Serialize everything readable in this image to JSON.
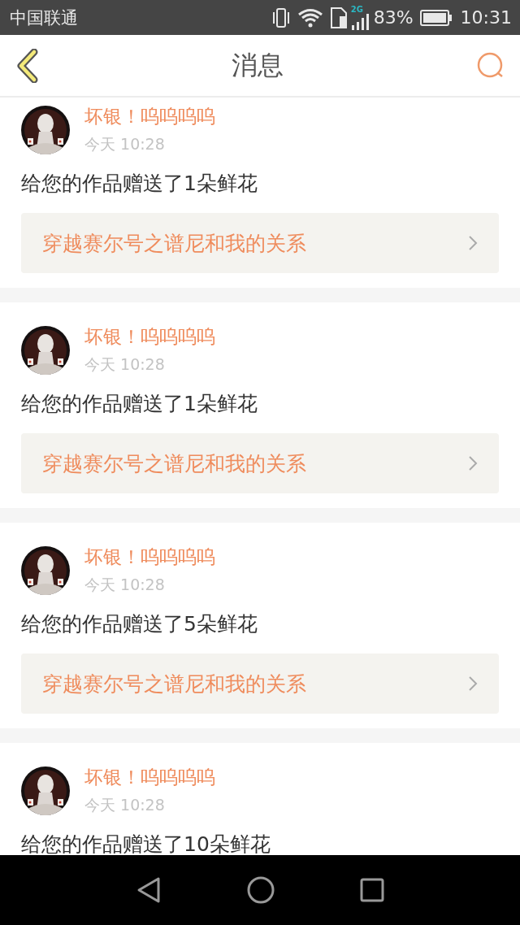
{
  "status_bar": {
    "carrier": "中国联通",
    "network": "2G",
    "battery": "83%",
    "time": "10:31"
  },
  "header": {
    "title": "消息"
  },
  "messages": [
    {
      "sender": "坏银！呜呜呜呜",
      "time": "今天 10:28",
      "text": "给您的作品赠送了1朵鲜花",
      "work": "穿越赛尔号之谱尼和我的关系"
    },
    {
      "sender": "坏银！呜呜呜呜",
      "time": "今天 10:28",
      "text": "给您的作品赠送了1朵鲜花",
      "work": "穿越赛尔号之谱尼和我的关系"
    },
    {
      "sender": "坏银！呜呜呜呜",
      "time": "今天 10:28",
      "text": "给您的作品赠送了5朵鲜花",
      "work": "穿越赛尔号之谱尼和我的关系"
    },
    {
      "sender": "坏银！呜呜呜呜",
      "time": "今天 10:28",
      "text": "给您的作品赠送了10朵鲜花"
    }
  ]
}
